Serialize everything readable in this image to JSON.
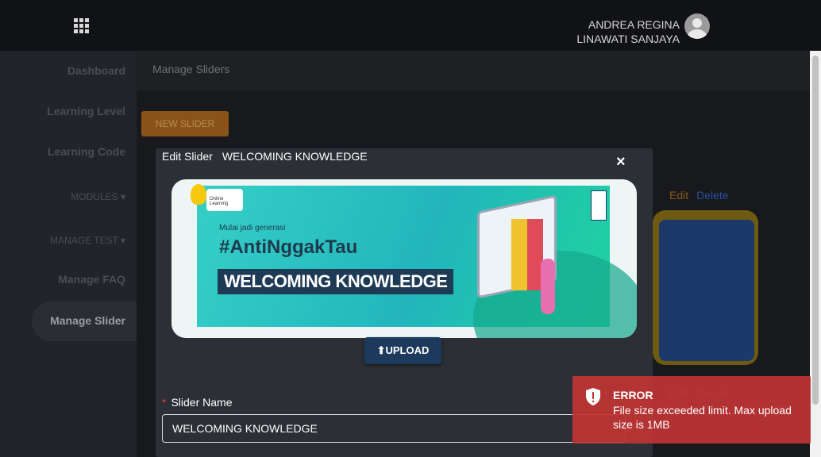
{
  "user": {
    "name_line1": "ANDREA REGINA",
    "name_line2": "LINAWATI SANJAYA"
  },
  "sidebar": {
    "items": [
      {
        "label": "Dashboard"
      },
      {
        "label": "Learning Level"
      },
      {
        "label": "Learning Code"
      },
      {
        "label": "MODULES"
      },
      {
        "label": "MANAGE TEST"
      },
      {
        "label": "Manage FAQ"
      },
      {
        "label": "Manage Slider",
        "active": true
      }
    ]
  },
  "page": {
    "title": "Manage Sliders",
    "new_button": "NEW SLIDER"
  },
  "card": {
    "edit": "Edit",
    "delete": "Delete"
  },
  "modal": {
    "title_prefix": "Edit Slider",
    "title_name": "WELCOMING KNOWLEDGE",
    "close": "×",
    "banner": {
      "tag": "Online Learning",
      "subtitle": "Mulai jadi generasi",
      "hashtag": "#AntiNggakTau",
      "headline": "WELCOMING KNOWLEDGE"
    },
    "upload_label": "UPLOAD",
    "field_label": "Slider Name",
    "field_value": "WELCOMING KNOWLEDGE"
  },
  "toast": {
    "title": "ERROR",
    "message": "File size exceeded limit. Max upload size is 1MB",
    "color": "#be3535"
  }
}
